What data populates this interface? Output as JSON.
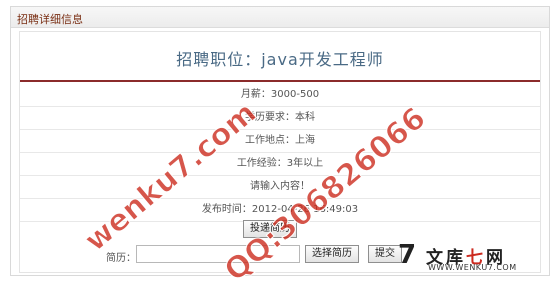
{
  "panel": {
    "title": "招聘详细信息"
  },
  "job": {
    "title_prefix": "招聘职位：",
    "title_name": "java开发工程师"
  },
  "details": [
    {
      "text": "月薪：3000-500"
    },
    {
      "text": "学历要求：本科"
    },
    {
      "text": "工作地点：上海"
    },
    {
      "text": "工作经验：3年以上"
    },
    {
      "text": "请输入内容！"
    },
    {
      "text": "发布时间：2012-04-26 16:49:03"
    }
  ],
  "buttons": {
    "submit_resume": "投递简历",
    "choose_resume": "选择简历",
    "submit": "提交"
  },
  "resume": {
    "label": "简历：",
    "value": ""
  },
  "watermarks": {
    "site": "wenku7.com",
    "qq": "QQ:306826066"
  },
  "logo": {
    "mark": "7",
    "text_a": "文库",
    "text_b": "七",
    "text_c": "网",
    "url": "WWW.WENKU7.COM"
  },
  "colors": {
    "title_text": "#4a6a85",
    "divider": "#8b2b2b",
    "panel_title": "#7a2f14",
    "watermark": "#cc2c1e"
  }
}
